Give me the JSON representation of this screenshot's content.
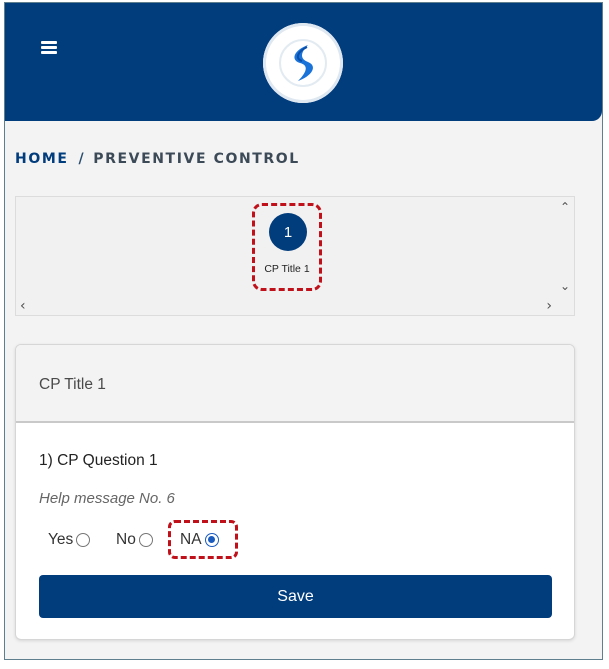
{
  "topbar": {
    "menu_icon": "hamburger-menu-icon",
    "logo_icon": "app-logo-icon",
    "brand_color": "#013c7d"
  },
  "breadcrumb": {
    "home": "HOME",
    "separator": "/",
    "current": "PREVENTIVE CONTROL"
  },
  "steps": {
    "items": [
      {
        "number": "1",
        "label": "CP Title 1",
        "active": true
      }
    ]
  },
  "card": {
    "title": "CP Title 1",
    "question": "1) CP Question 1",
    "help": "Help message No. 6",
    "options": [
      {
        "label": "Yes",
        "checked": false
      },
      {
        "label": "No",
        "checked": false
      },
      {
        "label": "NA",
        "checked": true
      }
    ],
    "save_label": "Save"
  },
  "highlight_color": "#c0101a"
}
